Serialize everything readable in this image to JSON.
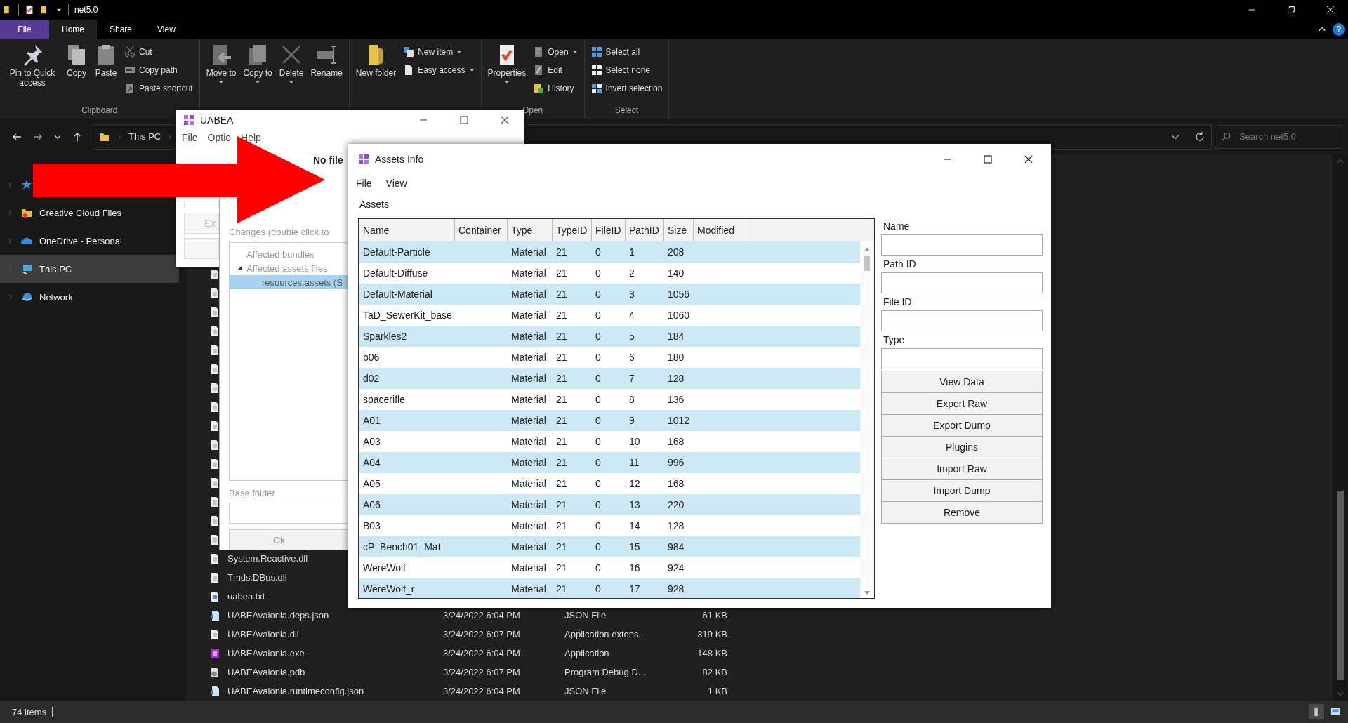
{
  "explorer": {
    "title": "net5.0",
    "ribbon_tabs": [
      {
        "label": "File",
        "kind": "menu",
        "selected": false
      },
      {
        "label": "Home",
        "kind": "tab",
        "selected": true
      },
      {
        "label": "Share",
        "kind": "tab",
        "selected": false
      },
      {
        "label": "View",
        "kind": "tab",
        "selected": false
      }
    ],
    "help_button": "?",
    "ribbon_groups": [
      {
        "label": "Clipboard",
        "commands": [
          {
            "kind": "large",
            "label": "Pin to Quick access",
            "dropdown": false
          },
          {
            "kind": "large",
            "label": "Copy",
            "dropdown": false
          },
          {
            "kind": "large",
            "label": "Paste",
            "dropdown": false
          },
          {
            "kind": "small",
            "label": "Cut",
            "dropdown": false
          },
          {
            "kind": "small",
            "label": "Copy path",
            "dropdown": false
          },
          {
            "kind": "small",
            "label": "Paste shortcut",
            "dropdown": false
          }
        ]
      },
      {
        "commands": [
          {
            "kind": "large",
            "label": "Move to",
            "dropdown": true
          },
          {
            "kind": "large",
            "label": "Copy to",
            "dropdown": true
          },
          {
            "kind": "large",
            "label": "Delete",
            "dropdown": true
          },
          {
            "kind": "large",
            "label": "Rename",
            "dropdown": false
          }
        ]
      },
      {
        "commands": [
          {
            "kind": "large",
            "label": "New folder",
            "dropdown": false
          },
          {
            "kind": "small",
            "label": "New item",
            "dropdown": true
          },
          {
            "kind": "small",
            "label": "Easy access",
            "dropdown": true
          }
        ]
      },
      {
        "label": "Open",
        "commands": [
          {
            "kind": "large",
            "label": "Properties",
            "dropdown": true
          },
          {
            "kind": "small",
            "label": "Open",
            "dropdown": true
          },
          {
            "kind": "small",
            "label": "Edit",
            "dropdown": false
          },
          {
            "kind": "small",
            "label": "History",
            "dropdown": false
          }
        ]
      },
      {
        "label": "Select",
        "commands": [
          {
            "kind": "small",
            "label": "Select all",
            "dropdown": false
          },
          {
            "kind": "small",
            "label": "Select none",
            "dropdown": false
          },
          {
            "kind": "small",
            "label": "Invert selection",
            "dropdown": false
          }
        ]
      }
    ],
    "address": {
      "crumbs": [
        "This PC"
      ]
    },
    "search": {
      "placeholder": "Search net5.0"
    },
    "nav_items": [
      {
        "selected": false
      },
      {
        "label": "Creative Cloud Files",
        "selected": false
      },
      {
        "label": "OneDrive - Personal",
        "selected": false
      },
      {
        "label": "This PC",
        "selected": true
      },
      {
        "label": "Network",
        "selected": false
      }
    ],
    "file_rows": [
      {
        "kind": "document"
      },
      {
        "kind": "document"
      },
      {
        "kind": "document"
      },
      {
        "kind": "document"
      },
      {
        "kind": "document"
      },
      {
        "kind": "document"
      },
      {
        "kind": "document"
      },
      {
        "kind": "document"
      },
      {
        "kind": "document"
      },
      {
        "kind": "document"
      },
      {
        "kind": "document"
      },
      {
        "kind": "document"
      },
      {
        "kind": "document"
      },
      {
        "kind": "document"
      },
      {
        "kind": "document"
      },
      {
        "kind": "document",
        "name": "System.Reactive.dll"
      },
      {
        "kind": "document",
        "name": "Tmds.DBus.dll"
      },
      {
        "kind": "text",
        "name": "uabea.txt"
      },
      {
        "kind": "script",
        "name": "UABEAvalonia.deps.json",
        "date": "3/24/2022 6:04 PM",
        "type": "JSON File",
        "size": "61 KB"
      },
      {
        "kind": "document",
        "name": "UABEAvalonia.dll",
        "date": "3/24/2022 6:07 PM",
        "type": "Application extens...",
        "size": "319 KB"
      },
      {
        "kind": "app",
        "name": "UABEAvalonia.exe",
        "date": "3/24/2022 6:04 PM",
        "type": "Application",
        "size": "148 KB"
      },
      {
        "kind": "database",
        "name": "UABEAvalonia.pdb",
        "date": "3/24/2022 6:07 PM",
        "type": "Program Debug D...",
        "size": "82 KB"
      },
      {
        "kind": "script",
        "name": "UABEAvalonia.runtimeconfig.json",
        "date": "3/24/2022 6:04 PM",
        "type": "JSON File",
        "size": "1 KB"
      }
    ],
    "status": {
      "item_count": "74 items"
    }
  },
  "uabea": {
    "title": "UABEA",
    "menu": [
      "File",
      "Optio",
      "Help"
    ],
    "heading": "No file",
    "button": "Ex"
  },
  "changes": {
    "label": "Changes (double click to",
    "tree": [
      {
        "label": "Affected bundles",
        "selected": false
      },
      {
        "label": "Affected assets files",
        "selected": false,
        "expanded": true,
        "children": [
          {
            "label": "resources.assets (S",
            "selected": true
          }
        ]
      }
    ],
    "base_folder_label": "Base folder",
    "ok_button": "Ok"
  },
  "assets": {
    "title": "Assets Info",
    "menu": [
      "File",
      "View"
    ],
    "section_label": "Assets",
    "columns": [
      "Name",
      "Container",
      "Type",
      "TypeID",
      "FileID",
      "PathID",
      "Size",
      "Modified"
    ],
    "rows": [
      {
        "name": "Default-Particle",
        "type": "Material",
        "type_id": "21",
        "file_id": "0",
        "path_id": "1",
        "size": "208"
      },
      {
        "name": "Default-Diffuse",
        "type": "Material",
        "type_id": "21",
        "file_id": "0",
        "path_id": "2",
        "size": "140"
      },
      {
        "name": "Default-Material",
        "type": "Material",
        "type_id": "21",
        "file_id": "0",
        "path_id": "3",
        "size": "1056"
      },
      {
        "name": "TaD_SewerKit_base",
        "type": "Material",
        "type_id": "21",
        "file_id": "0",
        "path_id": "4",
        "size": "1060"
      },
      {
        "name": "Sparkles2",
        "type": "Material",
        "type_id": "21",
        "file_id": "0",
        "path_id": "5",
        "size": "184"
      },
      {
        "name": "b06",
        "type": "Material",
        "type_id": "21",
        "file_id": "0",
        "path_id": "6",
        "size": "180"
      },
      {
        "name": "d02",
        "type": "Material",
        "type_id": "21",
        "file_id": "0",
        "path_id": "7",
        "size": "128"
      },
      {
        "name": "spacerifle",
        "type": "Material",
        "type_id": "21",
        "file_id": "0",
        "path_id": "8",
        "size": "136"
      },
      {
        "name": "A01",
        "type": "Material",
        "type_id": "21",
        "file_id": "0",
        "path_id": "9",
        "size": "1012"
      },
      {
        "name": "A03",
        "type": "Material",
        "type_id": "21",
        "file_id": "0",
        "path_id": "10",
        "size": "168"
      },
      {
        "name": "A04",
        "type": "Material",
        "type_id": "21",
        "file_id": "0",
        "path_id": "11",
        "size": "996"
      },
      {
        "name": "A05",
        "type": "Material",
        "type_id": "21",
        "file_id": "0",
        "path_id": "12",
        "size": "168"
      },
      {
        "name": "A06",
        "type": "Material",
        "type_id": "21",
        "file_id": "0",
        "path_id": "13",
        "size": "220"
      },
      {
        "name": "B03",
        "type": "Material",
        "type_id": "21",
        "file_id": "0",
        "path_id": "14",
        "size": "128"
      },
      {
        "name": "cP_Bench01_Mat",
        "type": "Material",
        "type_id": "21",
        "file_id": "0",
        "path_id": "15",
        "size": "984"
      },
      {
        "name": "WereWolf",
        "type": "Material",
        "type_id": "21",
        "file_id": "0",
        "path_id": "16",
        "size": "924"
      },
      {
        "name": "WereWolf_r",
        "type": "Material",
        "type_id": "21",
        "file_id": "0",
        "path_id": "17",
        "size": "928"
      }
    ],
    "fields": [
      {
        "label": "Name"
      },
      {
        "label": "Path ID"
      },
      {
        "label": "File ID"
      },
      {
        "label": "Type"
      }
    ],
    "buttons": [
      "View Data",
      "Export Raw",
      "Export Dump",
      "Plugins",
      "Import Raw",
      "Import Dump",
      "Remove"
    ]
  }
}
